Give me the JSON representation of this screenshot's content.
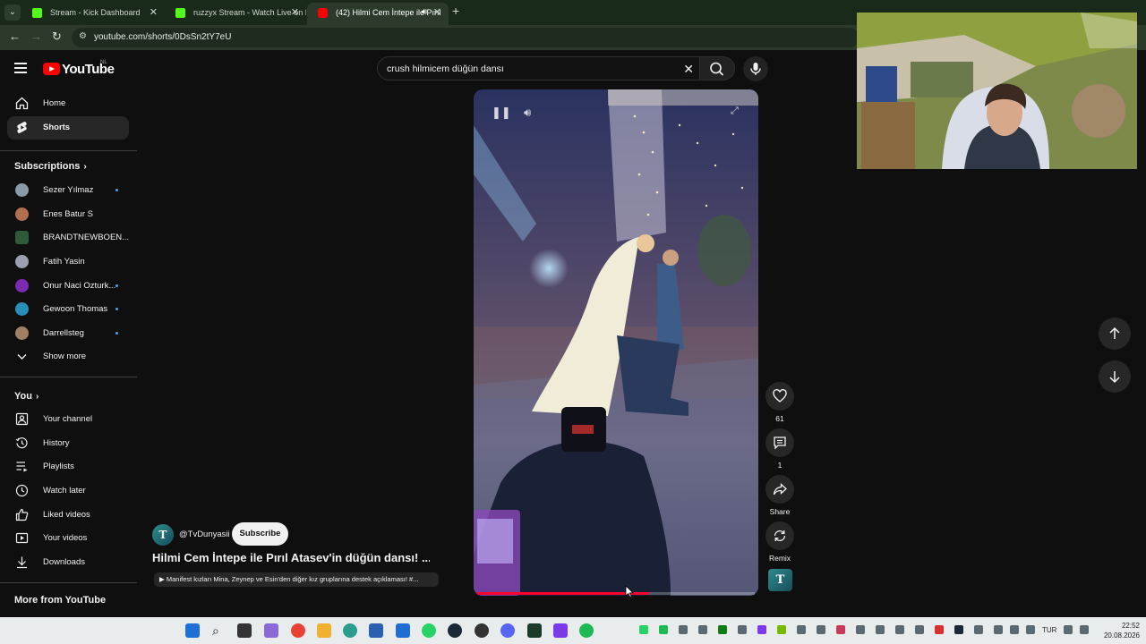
{
  "browser": {
    "tabs": [
      {
        "title": "Stream - Kick Dashboard",
        "favicon": "kick-icon"
      },
      {
        "title": "ruzzyx Stream - Watch Live on Kick",
        "favicon": "kick-icon"
      },
      {
        "title": "(42) Hilmi Cem İntepe ile Pırıl",
        "favicon": "youtube-icon",
        "active": true
      }
    ],
    "url": "youtube.com/shorts/0DsSn2tY7eU"
  },
  "header": {
    "logo_text": "YouTube",
    "country_code": "NL",
    "search_query": "crush hilmicem düğün dansı"
  },
  "sidebar": {
    "main": [
      {
        "label": "Home",
        "icon": "home-icon"
      },
      {
        "label": "Shorts",
        "icon": "shorts-icon",
        "active": true
      }
    ],
    "subscriptions_title": "Subscriptions",
    "subscriptions": [
      {
        "label": "Sezer Yılmaz",
        "live": true,
        "color": "#8a9aa8"
      },
      {
        "label": "Enes Batur S",
        "live": false,
        "color": "#b07050"
      },
      {
        "label": "BRANDTNEWBOEN...",
        "live": false,
        "color": "#2d5a3a"
      },
      {
        "label": "Fatih Yasin",
        "live": false,
        "color": "#9aa0b0"
      },
      {
        "label": "Onur Naci Ozturk...",
        "live": true,
        "color": "#7a2bb0"
      },
      {
        "label": "Gewoon Thomas",
        "live": true,
        "color": "#2a8fb8"
      },
      {
        "label": "Darrellsteg",
        "live": true,
        "color": "#a08060"
      }
    ],
    "show_more": "Show more",
    "you_title": "You",
    "you_items": [
      {
        "label": "Your channel",
        "icon": "channel-icon"
      },
      {
        "label": "History",
        "icon": "history-icon"
      },
      {
        "label": "Playlists",
        "icon": "playlists-icon"
      },
      {
        "label": "Watch later",
        "icon": "watch-later-icon"
      },
      {
        "label": "Liked videos",
        "icon": "like-icon"
      },
      {
        "label": "Your videos",
        "icon": "your-videos-icon"
      },
      {
        "label": "Downloads",
        "icon": "download-icon"
      }
    ],
    "more_title": "More from YouTube"
  },
  "short": {
    "channel_handle": "@TvDunyasii",
    "channel_initial": "T",
    "subscribe_label": "Subscribe",
    "title": "Hilmi Cem İntepe ile Pırıl Atasev'in düğün dansı! ...",
    "related": "▶ Manifest kızları Mina, Zeynep ve Esin'den diğer kız gruplarına destek açıklaması! #...",
    "progress": 0.62
  },
  "actions": {
    "likes": "61",
    "comments": "1",
    "share": "Share",
    "remix": "Remix"
  },
  "taskbar": {
    "lang": "TUR",
    "time": "22:52",
    "date": "20.08.2026"
  }
}
